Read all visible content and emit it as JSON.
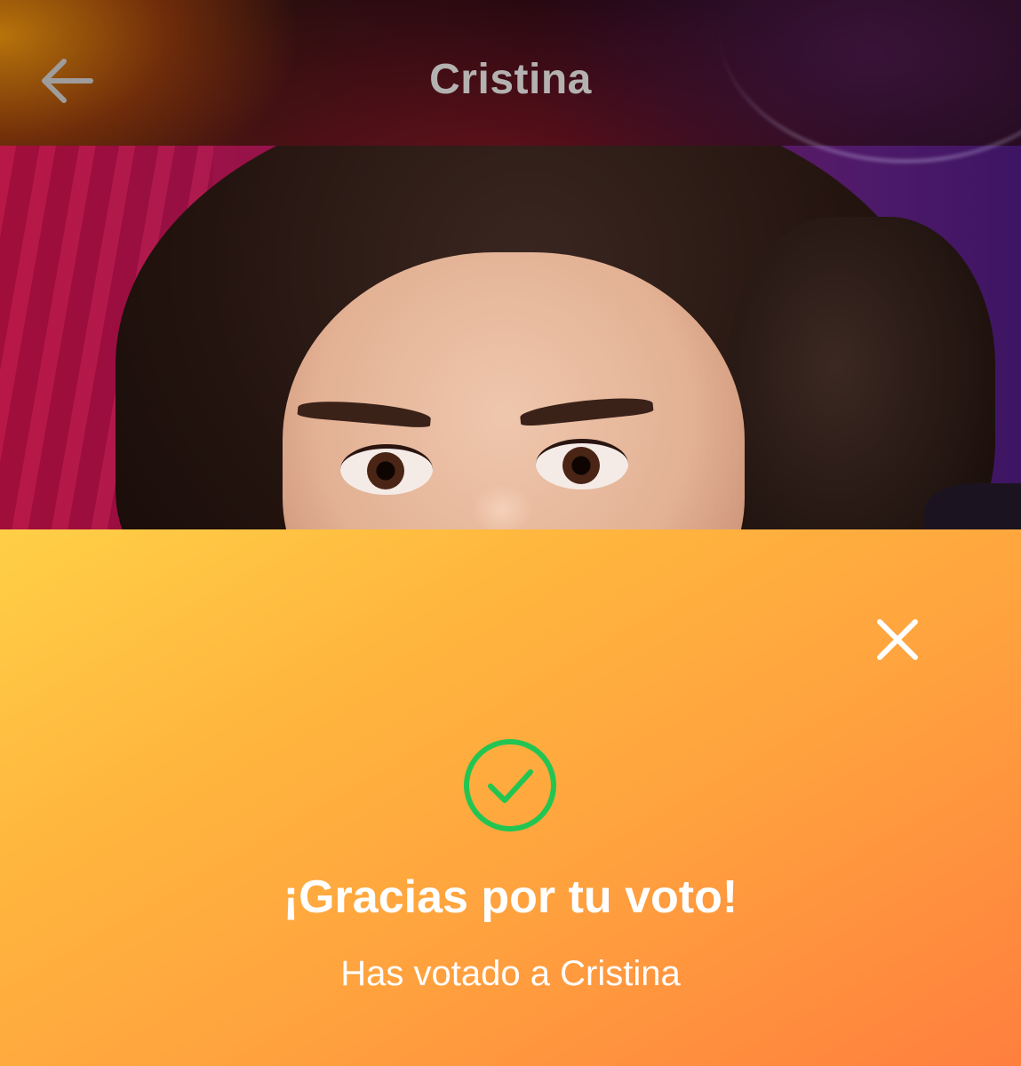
{
  "header": {
    "title": "Cristina",
    "back_icon": "arrow-left-icon"
  },
  "photo": {
    "alt": "Cristina"
  },
  "vote_sheet": {
    "close_icon": "close-icon",
    "status_icon": "check-circle-icon",
    "status_color": "#23c552",
    "title": "¡Gracias por tu voto!",
    "subtitle": "Has votado a Cristina"
  },
  "colors": {
    "sheet_gradient_start": "#ffcf46",
    "sheet_gradient_end": "#ff7f3e",
    "header_title_color": "#b4b1b1"
  }
}
